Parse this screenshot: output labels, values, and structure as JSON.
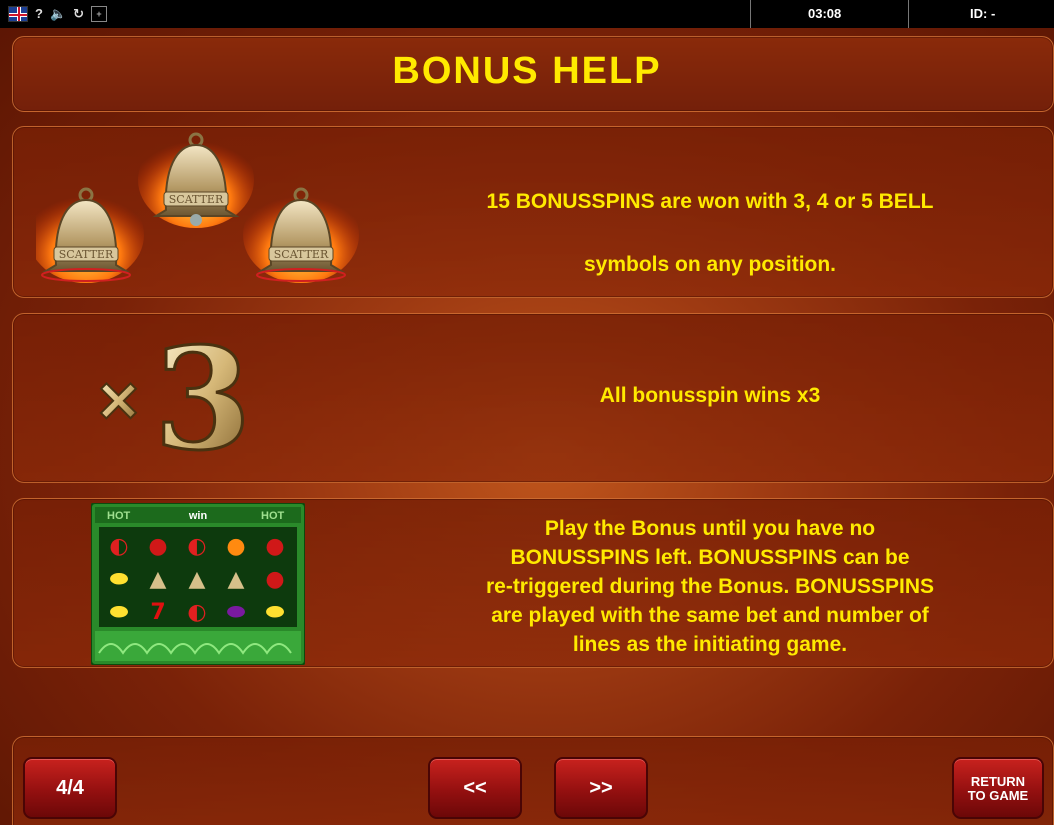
{
  "topbar": {
    "clock": "03:08",
    "id_label": "ID: -",
    "help_glyph": "?"
  },
  "title": "BONUS HELP",
  "rows": [
    {
      "icon": "scatter-bells-icon",
      "bell_label": "SCATTER",
      "text_line1": "15 BONUSSPINS are won with 3, 4 or 5 BELL",
      "text_line2": "symbols on any position."
    },
    {
      "icon": "x3-multiplier-icon",
      "multiplier": "x3",
      "text": "All bonusspin wins x3"
    },
    {
      "icon": "reels-preview-icon",
      "reels_header_left": "HOT",
      "reels_header_center": "win",
      "reels_header_right": "HOT",
      "text_lines": [
        "Play the Bonus until you have no",
        "BONUSSPINS left. BONUSSPINS can be",
        "re-triggered during the Bonus. BONUSSPINS",
        "are played with the same bet and number of",
        "lines as the initiating game."
      ]
    }
  ],
  "footer": {
    "page_label": "4/4",
    "prev_label": "<<",
    "next_label": ">>",
    "return_line1": "RETURN",
    "return_line2": "TO GAME"
  },
  "colors": {
    "accent_text": "#ffea00",
    "background": "#7a2208",
    "button": "#941010"
  }
}
